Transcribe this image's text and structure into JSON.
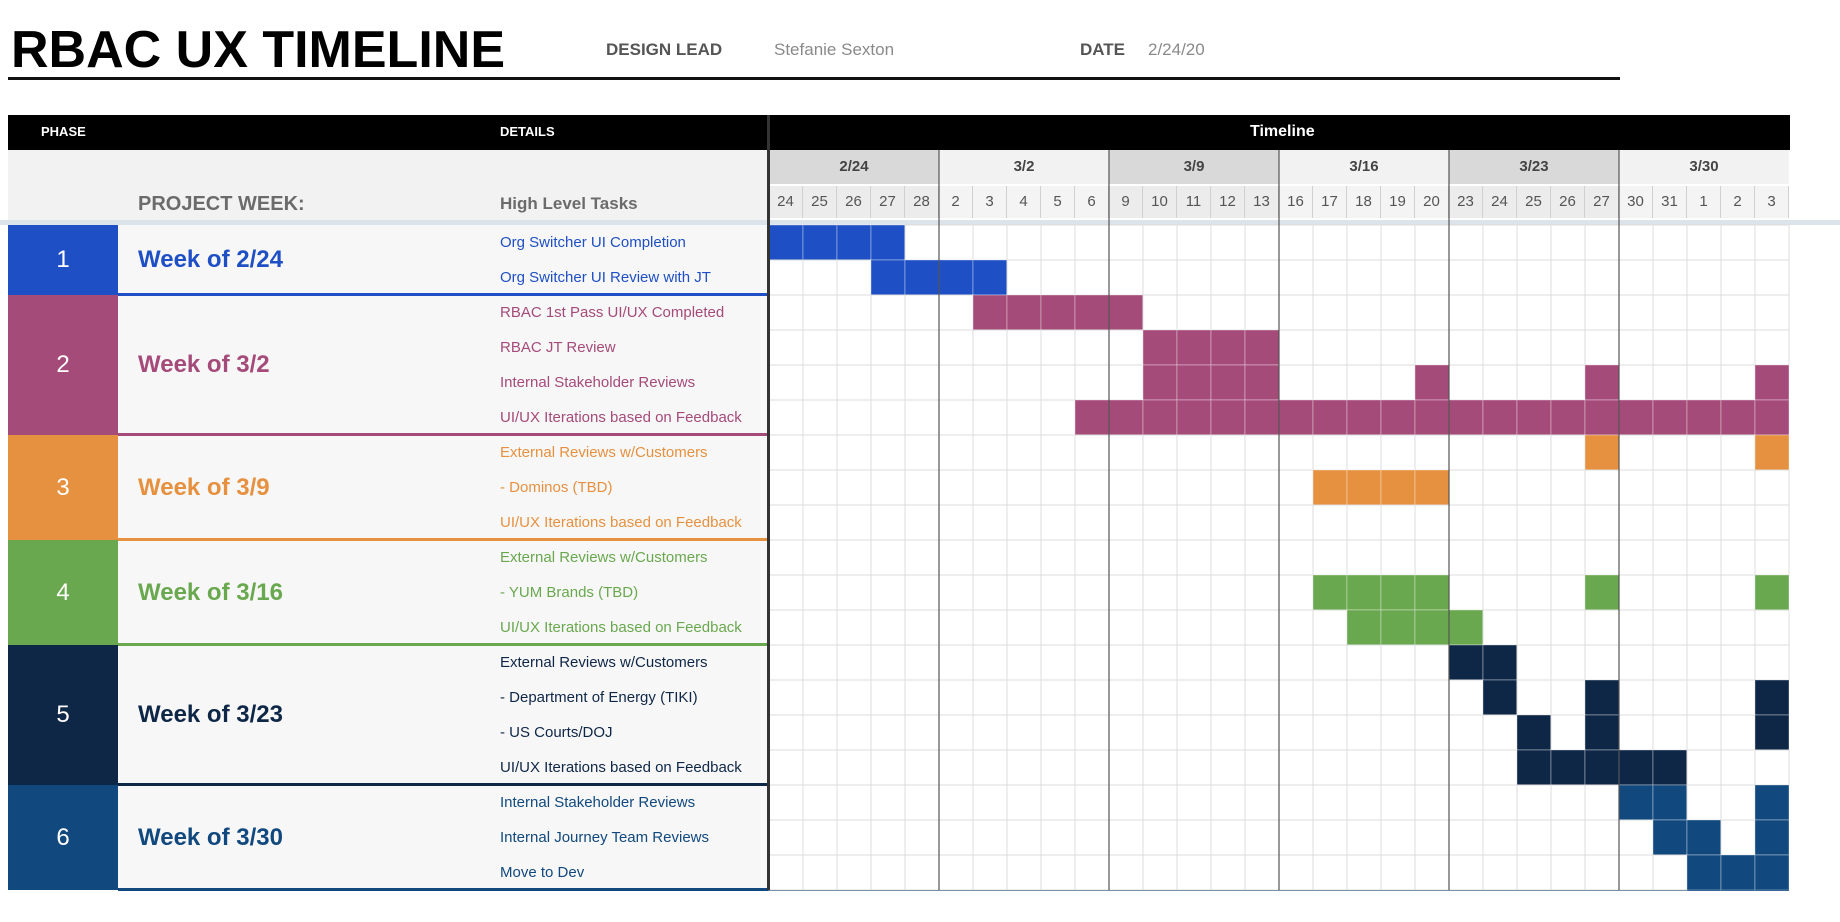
{
  "header": {
    "title": "RBAC UX TIMELINE",
    "design_lead_label": "DESIGN LEAD",
    "design_lead_value": "Stefanie Sexton",
    "date_label": "DATE",
    "date_value": "2/24/20"
  },
  "table_header": {
    "phase": "PHASE",
    "details": "DETAILS",
    "timeline": "Timeline",
    "project_week": "PROJECT WEEK:",
    "high_level_tasks": "High Level Tasks"
  },
  "weeks": [
    "2/24",
    "3/2",
    "3/9",
    "3/16",
    "3/23",
    "3/30"
  ],
  "days": [
    "24",
    "25",
    "26",
    "27",
    "28",
    "2",
    "3",
    "4",
    "5",
    "6",
    "9",
    "10",
    "11",
    "12",
    "13",
    "16",
    "17",
    "18",
    "19",
    "20",
    "23",
    "24",
    "25",
    "26",
    "27",
    "30",
    "31",
    "1",
    "2",
    "3"
  ],
  "colors": {
    "phase1": "#1f4fc4",
    "phase2": "#a54b7a",
    "phase3": "#e69140",
    "phase4": "#6aa84f",
    "phase5": "#0f2747",
    "phase6": "#11497e",
    "header_black": "#000000",
    "week_shade": "#d9d9d9"
  },
  "phases": [
    {
      "number": "1",
      "week": "Week of 2/24",
      "color": "#1f4fc4",
      "tasks": [
        {
          "label": "Org Switcher UI Completion",
          "days": [
            0,
            1,
            2,
            3
          ]
        },
        {
          "label": "Org Switcher UI Review with JT",
          "days": [
            3,
            4,
            5,
            6
          ]
        }
      ]
    },
    {
      "number": "2",
      "week": "Week of 3/2",
      "color": "#a54b7a",
      "tasks": [
        {
          "label": "RBAC 1st Pass UI/UX Completed",
          "days": [
            6,
            7,
            8,
            9,
            10
          ]
        },
        {
          "label": "RBAC JT Review",
          "days": [
            11,
            12,
            13,
            14
          ]
        },
        {
          "label": "Internal Stakeholder Reviews",
          "days": [
            11,
            12,
            13,
            14,
            19,
            24,
            29
          ]
        },
        {
          "label": "UI/UX Iterations based on Feedback",
          "days": [
            9,
            10,
            11,
            12,
            13,
            14,
            15,
            16,
            17,
            18,
            19,
            20,
            21,
            22,
            23,
            24,
            25,
            26,
            27,
            28,
            29
          ]
        }
      ]
    },
    {
      "number": "3",
      "week": "Week of 3/9",
      "color": "#e69140",
      "tasks": [
        {
          "label": "External Reviews w/Customers",
          "days": [
            24,
            29
          ]
        },
        {
          "label": "- Dominos (TBD)",
          "days": [
            16,
            17,
            18,
            19
          ]
        },
        {
          "label": "UI/UX Iterations based on Feedback",
          "days": []
        }
      ]
    },
    {
      "number": "4",
      "week": "Week of 3/16",
      "color": "#6aa84f",
      "tasks": [
        {
          "label": "External Reviews w/Customers",
          "days": []
        },
        {
          "label": "- YUM Brands (TBD)",
          "days": [
            16,
            17,
            18,
            19,
            24,
            29
          ]
        },
        {
          "label": "UI/UX Iterations based on Feedback",
          "days": [
            17,
            18,
            19,
            20
          ]
        }
      ]
    },
    {
      "number": "5",
      "week": "Week of 3/23",
      "color": "#0f2747",
      "tasks": [
        {
          "label": "External Reviews w/Customers",
          "days": [
            20,
            21
          ]
        },
        {
          "label": "- Department of Energy (TIKI)",
          "days": [
            21,
            24,
            29
          ]
        },
        {
          "label": "- US Courts/DOJ",
          "days": [
            22,
            24,
            29
          ]
        },
        {
          "label": "UI/UX Iterations based on Feedback",
          "days": [
            22,
            23,
            24,
            25,
            26
          ]
        }
      ]
    },
    {
      "number": "6",
      "week": "Week of 3/30",
      "color": "#11497e",
      "tasks": [
        {
          "label": "Internal Stakeholder Reviews",
          "days": [
            25,
            26,
            29
          ]
        },
        {
          "label": "Internal Journey Team Reviews",
          "days": [
            26,
            27,
            29
          ]
        },
        {
          "label": "Move to Dev",
          "days": [
            27,
            28,
            29
          ]
        }
      ]
    }
  ]
}
